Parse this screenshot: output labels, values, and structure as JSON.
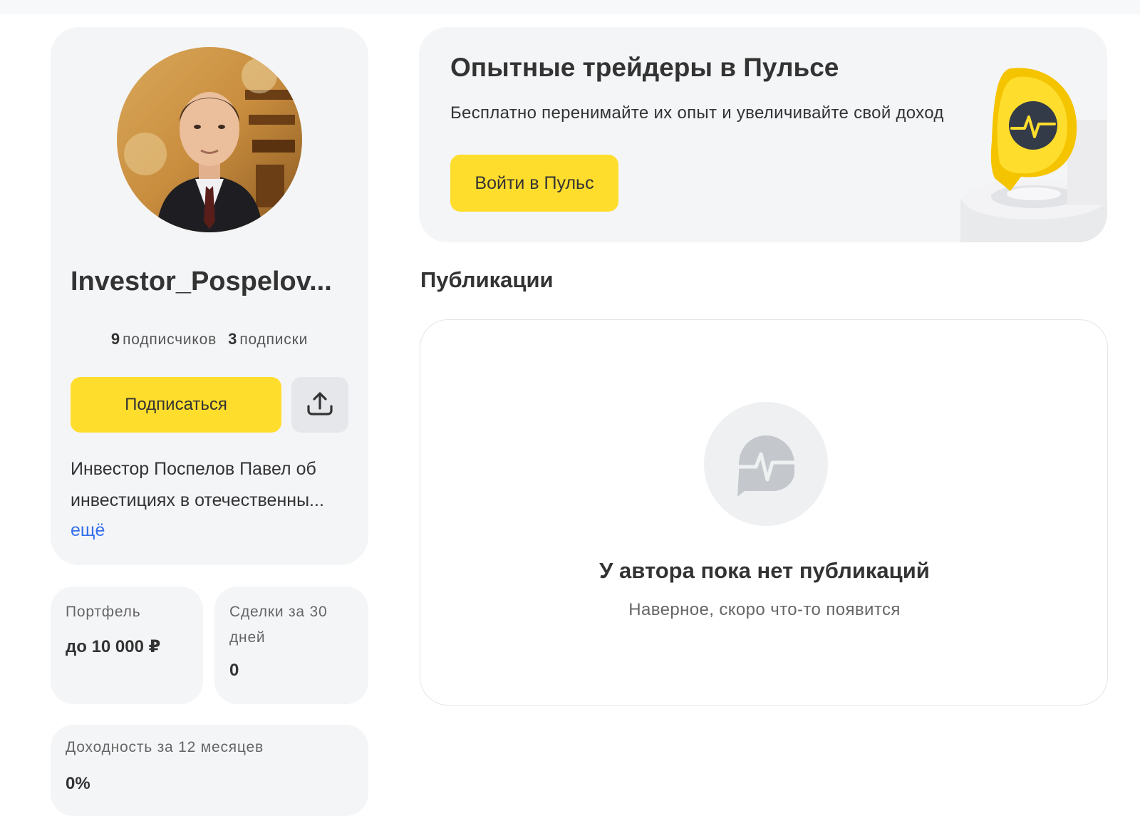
{
  "profile": {
    "username": "Investor_Pospelov...",
    "followers_count": "9",
    "followers_label": "подписчиков",
    "following_count": "3",
    "following_label": "подписки",
    "subscribe_label": "Подписаться",
    "description_line1": "Инвестор Поспелов Павел об",
    "description_line2": "инвестициях в отечественны...",
    "more_label": "ещё"
  },
  "stats": {
    "portfolio_label": "Портфель",
    "portfolio_value": "до 10 000 ₽",
    "deals_label_line1": "Сделки за 30",
    "deals_label_line2": "дней",
    "deals_value": "0",
    "yield_label": "Доходность за 12 месяцев",
    "yield_value": "0%"
  },
  "promo": {
    "title": "Опытные трейдеры в Пульсе",
    "subtitle": "Бесплатно перенимайте их опыт и увеличивайте свой доход",
    "button_label": "Войти в Пульс"
  },
  "publications": {
    "section_title": "Публикации",
    "empty_title": "У автора пока нет публикаций",
    "empty_subtitle": "Наверное, скоро что-то появится"
  },
  "colors": {
    "accent_yellow": "#ffdd2d",
    "link_blue": "#336fee",
    "card_bg": "#f4f5f7"
  },
  "icons": {
    "share": "share-upload-icon",
    "pulse": "pulse-logo-icon",
    "avatar": "user-avatar"
  }
}
